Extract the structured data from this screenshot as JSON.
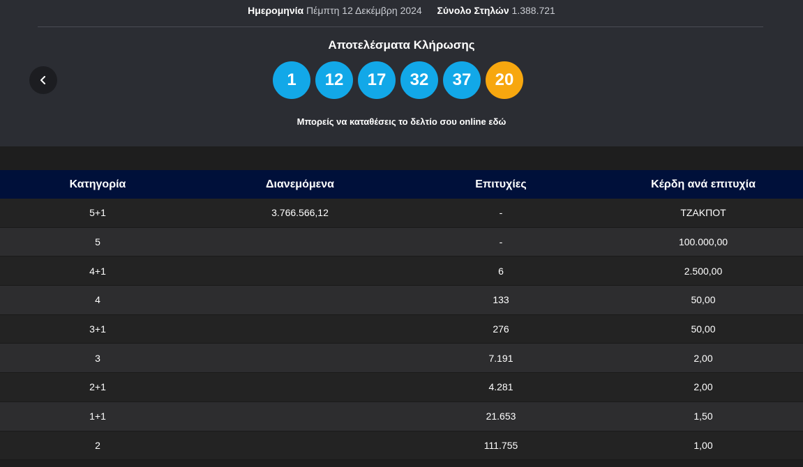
{
  "draw_info": {
    "date_label": "Ημερομηνία",
    "date_value": "Πέμπτη 12 Δεκέμβρη 2024",
    "columns_label": "Σύνολο Στηλών",
    "columns_value": "1.388.721"
  },
  "results": {
    "title": "Αποτελέσματα Κλήρωσης",
    "numbers": [
      "1",
      "12",
      "17",
      "32",
      "37"
    ],
    "bonus": "20",
    "online_text": "Μπορείς να καταθέσεις το δελτίο σου online εδώ"
  },
  "colors": {
    "ball": "#12a8e8",
    "bonus_ball": "#f7a70f",
    "table_header": "#00103a"
  },
  "icons": {
    "prev": "chevron-left-icon"
  },
  "table": {
    "headers": [
      "Κατηγορία",
      "Διανεμόμενα",
      "Επιτυχίες",
      "Κέρδη ανά επιτυχία"
    ],
    "rows": [
      [
        "5+1",
        "3.766.566,12",
        "-",
        "ΤΖΑΚΠΟΤ"
      ],
      [
        "5",
        "",
        "-",
        "100.000,00"
      ],
      [
        "4+1",
        "",
        "6",
        "2.500,00"
      ],
      [
        "4",
        "",
        "133",
        "50,00"
      ],
      [
        "3+1",
        "",
        "276",
        "50,00"
      ],
      [
        "3",
        "",
        "7.191",
        "2,00"
      ],
      [
        "2+1",
        "",
        "4.281",
        "2,00"
      ],
      [
        "1+1",
        "",
        "21.653",
        "1,50"
      ],
      [
        "2",
        "",
        "111.755",
        "1,00"
      ]
    ]
  }
}
